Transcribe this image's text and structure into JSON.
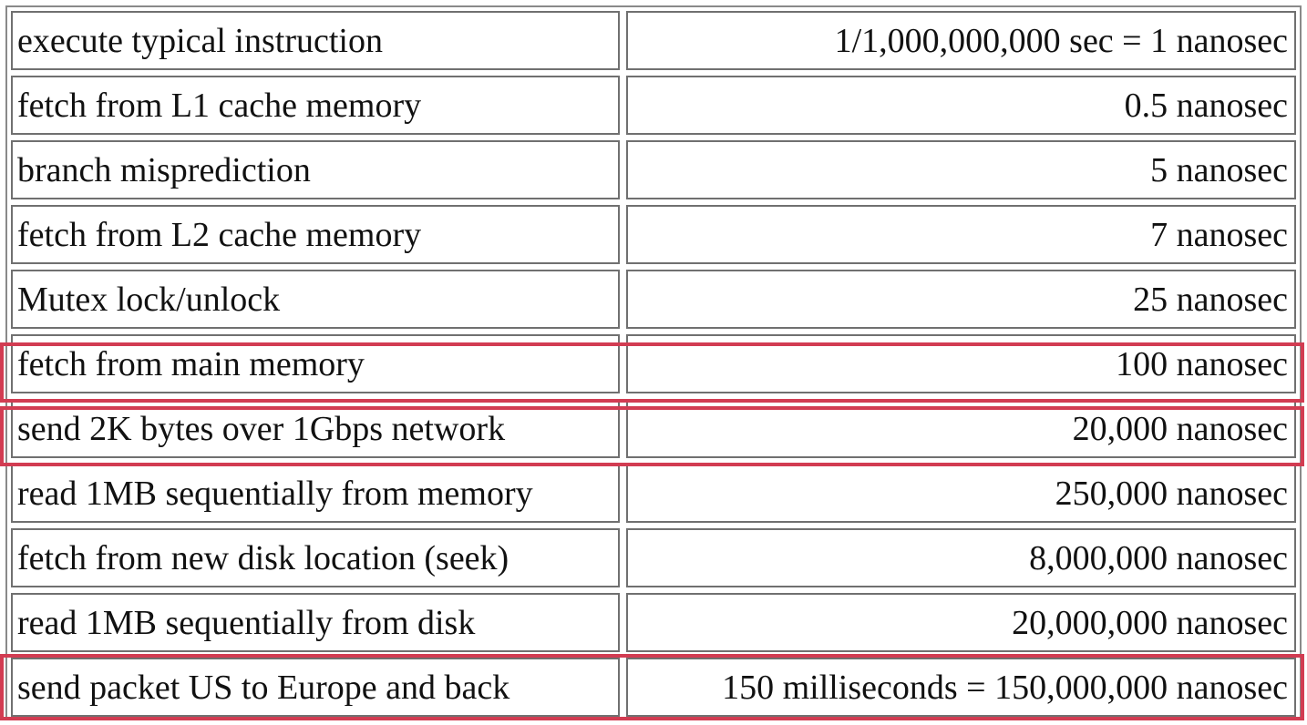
{
  "rows": [
    {
      "operation": "execute typical instruction",
      "time": "1/1,000,000,000 sec = 1 nanosec",
      "highlighted": false
    },
    {
      "operation": "fetch from L1 cache memory",
      "time": "0.5 nanosec",
      "highlighted": false
    },
    {
      "operation": "branch misprediction",
      "time": "5 nanosec",
      "highlighted": false
    },
    {
      "operation": "fetch from L2 cache memory",
      "time": "7 nanosec",
      "highlighted": false
    },
    {
      "operation": "Mutex lock/unlock",
      "time": "25 nanosec",
      "highlighted": false
    },
    {
      "operation": "fetch from main memory",
      "time": "100 nanosec",
      "highlighted": true
    },
    {
      "operation": "send 2K bytes over 1Gbps network",
      "time": "20,000 nanosec",
      "highlighted": true
    },
    {
      "operation": "read 1MB sequentially from memory",
      "time": "250,000 nanosec",
      "highlighted": false
    },
    {
      "operation": "fetch from new disk location (seek)",
      "time": "8,000,000 nanosec",
      "highlighted": false
    },
    {
      "operation": "read 1MB sequentially from disk",
      "time": "20,000,000 nanosec",
      "highlighted": false
    },
    {
      "operation": "send packet US to Europe and back",
      "time": "150 milliseconds = 150,000,000 nanosec",
      "highlighted": true
    }
  ],
  "colors": {
    "highlight_border": "#d23c52",
    "cell_border": "#707070",
    "text": "#111111"
  }
}
